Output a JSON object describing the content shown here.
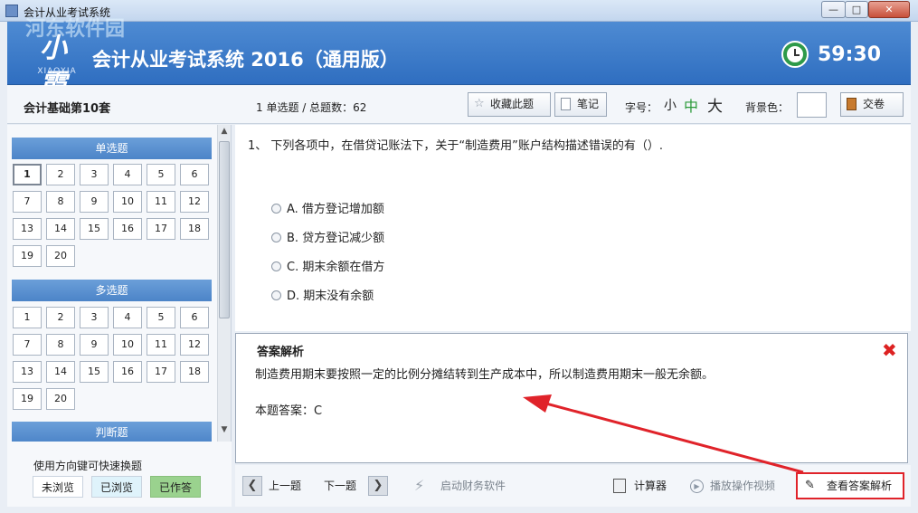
{
  "window": {
    "title": "会计从业考试系统",
    "min": "—",
    "max": "□",
    "close": "✕"
  },
  "header": {
    "logo_text": "小霞",
    "logo_sub": "XIAOXIA",
    "watermark": "河东软件园",
    "title": "会计从业考试系统 2016（通用版）",
    "timer": "59:30"
  },
  "infobar": {
    "set_name": "会计基础第10套",
    "progress": "1 单选题 / 总题数：62",
    "favorite": "收藏此题",
    "note": "笔记",
    "font_label": "字号：",
    "font_small": "小",
    "font_mid": "中",
    "font_large": "大",
    "bg_label": "背景色：",
    "submit": "交卷"
  },
  "nav": {
    "sections": [
      {
        "title": "单选题",
        "items": [
          "1",
          "2",
          "3",
          "4",
          "5",
          "6",
          "7",
          "8",
          "9",
          "10",
          "11",
          "12",
          "13",
          "14",
          "15",
          "16",
          "17",
          "18",
          "19",
          "20"
        ]
      },
      {
        "title": "多选题",
        "items": [
          "1",
          "2",
          "3",
          "4",
          "5",
          "6",
          "7",
          "8",
          "9",
          "10",
          "11",
          "12",
          "13",
          "14",
          "15",
          "16",
          "17",
          "18",
          "19",
          "20"
        ]
      },
      {
        "title": "判断题",
        "items": []
      }
    ],
    "hint": "使用方向键可快速换题",
    "legend": {
      "unseen": "未浏览",
      "seen": "已浏览",
      "answered": "已作答"
    }
  },
  "question": {
    "text": "1、 下列各项中，在借贷记账法下，关于“制造费用”账户结构描述错误的有（）.",
    "options": [
      "A. 借方登记增加额",
      "B. 贷方登记减少额",
      "C. 期末余额在借方",
      "D. 期末没有余额"
    ]
  },
  "analysis": {
    "title": "答案解析",
    "text": "制造费用期末要按照一定的比例分摊结转到生产成本中，所以制造费用期末一般无余额。",
    "answer": "本题答案：C"
  },
  "bottombar": {
    "prev": "上一题",
    "next": "下一题",
    "finance_software": "启动财务软件",
    "calculator": "计算器",
    "video": "播放操作视频",
    "view_analysis": "查看答案解析"
  },
  "colors": {
    "accent": "#2f6ec0",
    "highlight": "#e0232a",
    "answered": "#9ad28e"
  }
}
